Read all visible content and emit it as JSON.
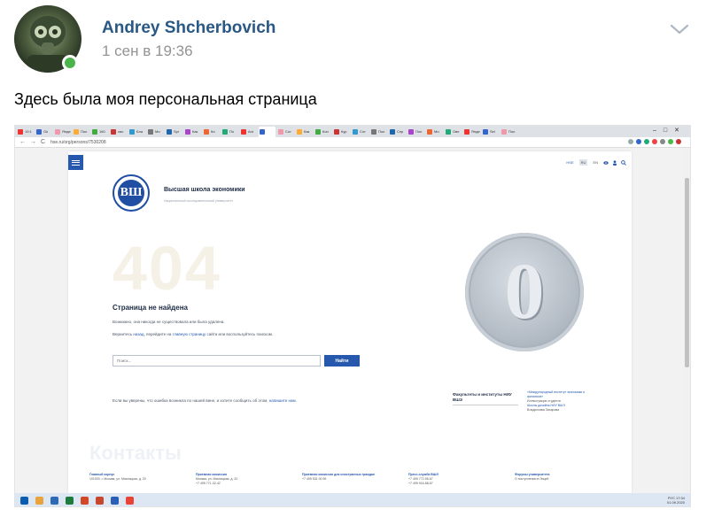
{
  "post": {
    "author": "Andrey Shcherbovich",
    "time": "1 сен в 19:36",
    "text": "Здесь была моя персональная страница"
  },
  "screenshot": {
    "tabs": [
      "19:1",
      "Gk",
      "Яндекс",
      "Пол",
      "160",
      "сво",
      "Бла",
      "Ми",
      "Spr",
      "Как",
      "Ки",
      "По",
      "Ant",
      "",
      "Сот",
      "Как",
      "Кон",
      "Кур",
      "Сот",
      "Пол",
      "Спр",
      "Пол",
      "Ми",
      "Ове",
      "Яндекс",
      "Sel",
      "Пол"
    ],
    "url": "hse.ru/org/persons/7530208",
    "lang_ru": "RU",
    "lang_en": "EN",
    "header_link": "HSE",
    "org_name": "Высшая школа экономики",
    "org_sub": "Национальный исследовательский университет",
    "logo_letters": "ВШ",
    "big_number": "404",
    "coin_digit": "0",
    "nf_title": "Страница не найдена",
    "nf_desc": "Возможно, она никогда не существовала или была удалена.",
    "nf_hint_1": "Вернитесь",
    "nf_hint_back": "назад",
    "nf_hint_2": ", перейдите на",
    "nf_hint_main": "главную страницу",
    "nf_hint_3": "сайта или воспользуйтесь поиском.",
    "search_placeholder": "Поиск...",
    "search_button": "Найти",
    "err_text_1": "Если вы уверены, что ошибка возникла по нашей вине, и хотите сообщить об этом,",
    "err_text_link": "напишите нам",
    "err_text_2": ".",
    "faculties": "Факультеты и институты НИУ ВШЭ",
    "caption_1": "«Международный институт экономики и финансов»",
    "caption_2": "Иллюстрация студента",
    "caption_3": "Школы дизайна НИУ ВШЭ",
    "caption_4": "Владислава Захарова",
    "contacts_title": "Контакты",
    "contact_cols": [
      {
        "h": "Главный корпус",
        "l1": "101000, г. Москва, ул. Мясницкая, д. 20",
        "l2": ""
      },
      {
        "h": "Приемная комиссия",
        "l1": "Москва, ул. Мясницкая, д. 20",
        "l2": "+7 495 771-32-42"
      },
      {
        "h": "Приемная комиссия для иностранных граждан",
        "l1": "+7 495 531 00 59",
        "l2": ""
      },
      {
        "h": "Пресс-служба ВШЭ",
        "l1": "+7 495 772-95-67",
        "l2": "+7 495 916-88-67"
      },
      {
        "h": "Форумы университета",
        "l1": "О поступлении в Лицей",
        "l2": ""
      }
    ],
    "tray_lang": "РУС",
    "tray_time": "17:34",
    "tray_date": "01.09.2020"
  },
  "colors": {
    "author_link": "#2a5885",
    "online": "#4bb34b",
    "hse_blue": "#2659ad"
  }
}
